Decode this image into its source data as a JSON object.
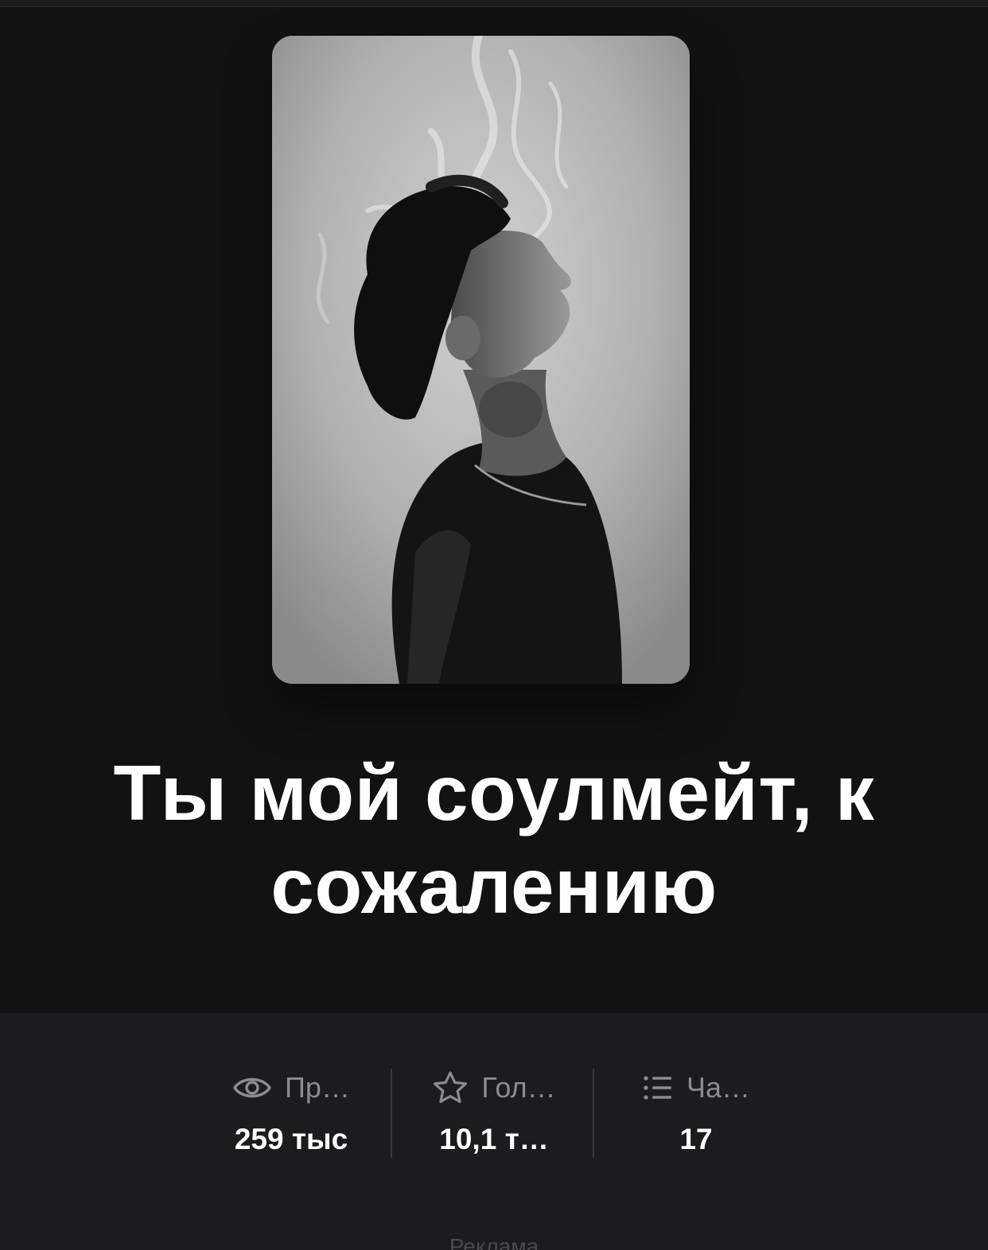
{
  "book": {
    "title": "Ты мой соулмейт, к сожалению",
    "cover_alt": "Black and white photo of a young man in profile exhaling smoke"
  },
  "stats": [
    {
      "icon": "eye-icon",
      "label": "Пр…",
      "value": "259 тыс"
    },
    {
      "icon": "star-icon",
      "label": "Гол…",
      "value": "10,1 т…"
    },
    {
      "icon": "list-icon",
      "label": "Ча…",
      "value": "17"
    }
  ],
  "ad": {
    "label": "Реклама"
  },
  "colors": {
    "background": "#121114",
    "panel": "#1c1b1f",
    "text": "#ffffff",
    "muted": "#8c8b90"
  }
}
